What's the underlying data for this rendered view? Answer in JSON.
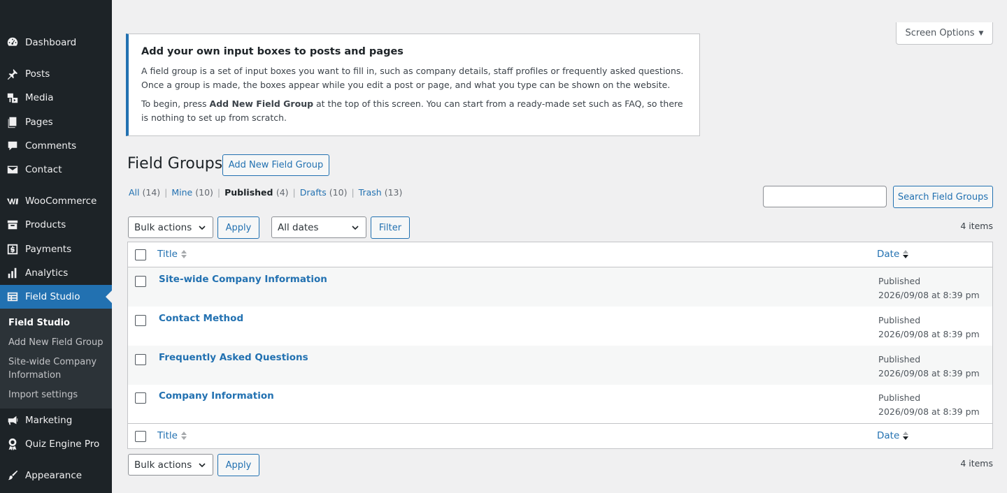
{
  "sidebar": {
    "items": [
      {
        "label": "Dashboard",
        "icon": "dashboard-icon"
      },
      {
        "label": "Posts",
        "icon": "pin-icon"
      },
      {
        "label": "Media",
        "icon": "media-icon"
      },
      {
        "label": "Pages",
        "icon": "pages-icon"
      },
      {
        "label": "Comments",
        "icon": "comment-icon"
      },
      {
        "label": "Contact",
        "icon": "envelope-icon"
      },
      {
        "label": "WooCommerce",
        "icon": "woo-icon"
      },
      {
        "label": "Products",
        "icon": "archive-icon"
      },
      {
        "label": "Payments",
        "icon": "dollar-icon"
      },
      {
        "label": "Analytics",
        "icon": "bar-chart-icon"
      },
      {
        "label": "Field Studio",
        "icon": "list-icon"
      },
      {
        "label": "Marketing",
        "icon": "megaphone-icon"
      },
      {
        "label": "Quiz Engine Pro",
        "icon": "award-icon"
      },
      {
        "label": "Appearance",
        "icon": "brush-icon"
      }
    ],
    "submenu": [
      {
        "label": "Field Studio"
      },
      {
        "label": "Add New Field Group"
      },
      {
        "label": "Site-wide Company Information"
      },
      {
        "label": "Import settings"
      }
    ]
  },
  "screen_options": {
    "label": "Screen Options"
  },
  "notice": {
    "title": "Add your own input boxes to posts and pages",
    "para1": "A field group is a set of input boxes you want to fill in, such as company details, staff profiles or frequently asked questions. Once a group is made, the boxes appear while you edit a post or page, and what you type can be shown on the website.",
    "para2_pre": "To begin, press ",
    "para2_bold": "Add New Field Group",
    "para2_post": " at the top of this screen. You can start from a ready-made set such as FAQ, so there is nothing to set up from scratch."
  },
  "header": {
    "title": "Field Groups",
    "add_new_label": "Add New Field Group"
  },
  "views": [
    {
      "label": "All",
      "count": "(14)"
    },
    {
      "label": "Mine",
      "count": "(10)"
    },
    {
      "label": "Published",
      "count": "(4)"
    },
    {
      "label": "Drafts",
      "count": "(10)"
    },
    {
      "label": "Trash",
      "count": "(13)"
    }
  ],
  "search": {
    "placeholder": "",
    "button_label": "Search Field Groups"
  },
  "tablenav": {
    "bulk_label": "Bulk actions",
    "apply_label": "Apply",
    "dates_label": "All dates",
    "filter_label": "Filter",
    "items_count": "4 items"
  },
  "table": {
    "col_title": "Title",
    "col_date": "Date",
    "rows": [
      {
        "title": "Site-wide Company Information",
        "status": "Published",
        "date": "2026/09/08 at 8:39 pm"
      },
      {
        "title": "Contact Method",
        "status": "Published",
        "date": "2026/09/08 at 8:39 pm"
      },
      {
        "title": "Frequently Asked Questions",
        "status": "Published",
        "date": "2026/09/08 at 8:39 pm"
      },
      {
        "title": "Company Information",
        "status": "Published",
        "date": "2026/09/08 at 8:39 pm"
      }
    ]
  }
}
